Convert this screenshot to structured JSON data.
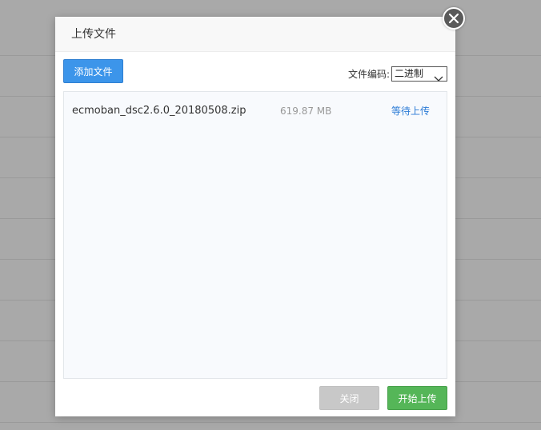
{
  "dialog": {
    "title": "上传文件",
    "close_icon": "close-icon"
  },
  "toolbar": {
    "add_file_label": "添加文件",
    "encoding_label": "文件编码:",
    "encoding_value": "二进制"
  },
  "files": [
    {
      "name": "ecmoban_dsc2.6.0_20180508.zip",
      "size": "619.87 MB",
      "status": "等待上传"
    }
  ],
  "footer": {
    "close_label": "关闭",
    "start_upload_label": "开始上传"
  },
  "colors": {
    "primary_blue": "#3c95ea",
    "success_green": "#55b658",
    "disabled_gray": "#c8c8c8",
    "status_blue": "#2b7bd6"
  }
}
